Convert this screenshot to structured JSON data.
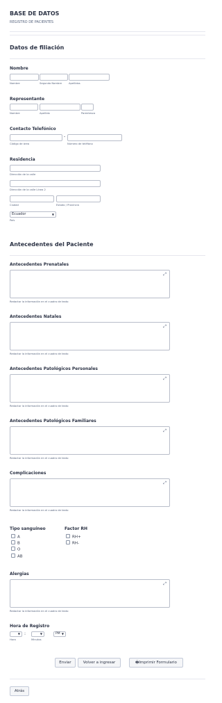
{
  "header": {
    "title": "BASE DE DATOS",
    "subtitle": "REGISTRO DE PACIENTES"
  },
  "filiacion": {
    "heading": "Datos de filiación",
    "nombre": {
      "label": "Nombre",
      "sub_first": "Nombre",
      "sub_middle": "Segundo Nombre",
      "sub_last": "Apellidos"
    },
    "representante": {
      "label": "Representante",
      "sub_name": "Nombre",
      "sub_last": "Apellido",
      "sub_rel": "Parentesco"
    },
    "contacto": {
      "label": "Contacto Telefónico",
      "dash": "-",
      "sub_area": "Código de área",
      "sub_number": "Número de teléfono"
    },
    "residencia": {
      "label": "Residencia",
      "sub_street": "Dirección de la calle",
      "sub_street2": "Dirección de la calle Línea 2",
      "sub_city": "Ciudad",
      "sub_state": "Estado / Provincia",
      "country_value": "Ecuador",
      "sub_country": "País"
    }
  },
  "antecedentes": {
    "heading": "Antecedentes del Paciente",
    "helper": "Redactar la información en el cuadro de texto",
    "expand_icon": "⤢",
    "prenatales": "Antecedentes Prenatales",
    "natales": "Antecedentes Natales",
    "personales": "Antecedentes Patológicos Personales",
    "familiares": "Antecedentes Patológicos Familiares",
    "complicaciones": "Complicaciones"
  },
  "sangre": {
    "tipo_label": "Tipo sanguíneo",
    "tipo_options": [
      "A",
      "B",
      "O",
      "AB"
    ],
    "rh_label": "Factor RH",
    "rh_options": [
      "RH+",
      "RH-"
    ]
  },
  "alergias": {
    "label": "Alergias"
  },
  "hora": {
    "label": "Hora de Registro",
    "colon": ":",
    "ampm": "PM",
    "sub_hour": "Hora",
    "sub_min": "Minutos"
  },
  "buttons": {
    "enviar": "Enviar",
    "volver": "Volver a ingresar",
    "imprimir": "Imprimir Formulario",
    "atras": "Atrás"
  }
}
